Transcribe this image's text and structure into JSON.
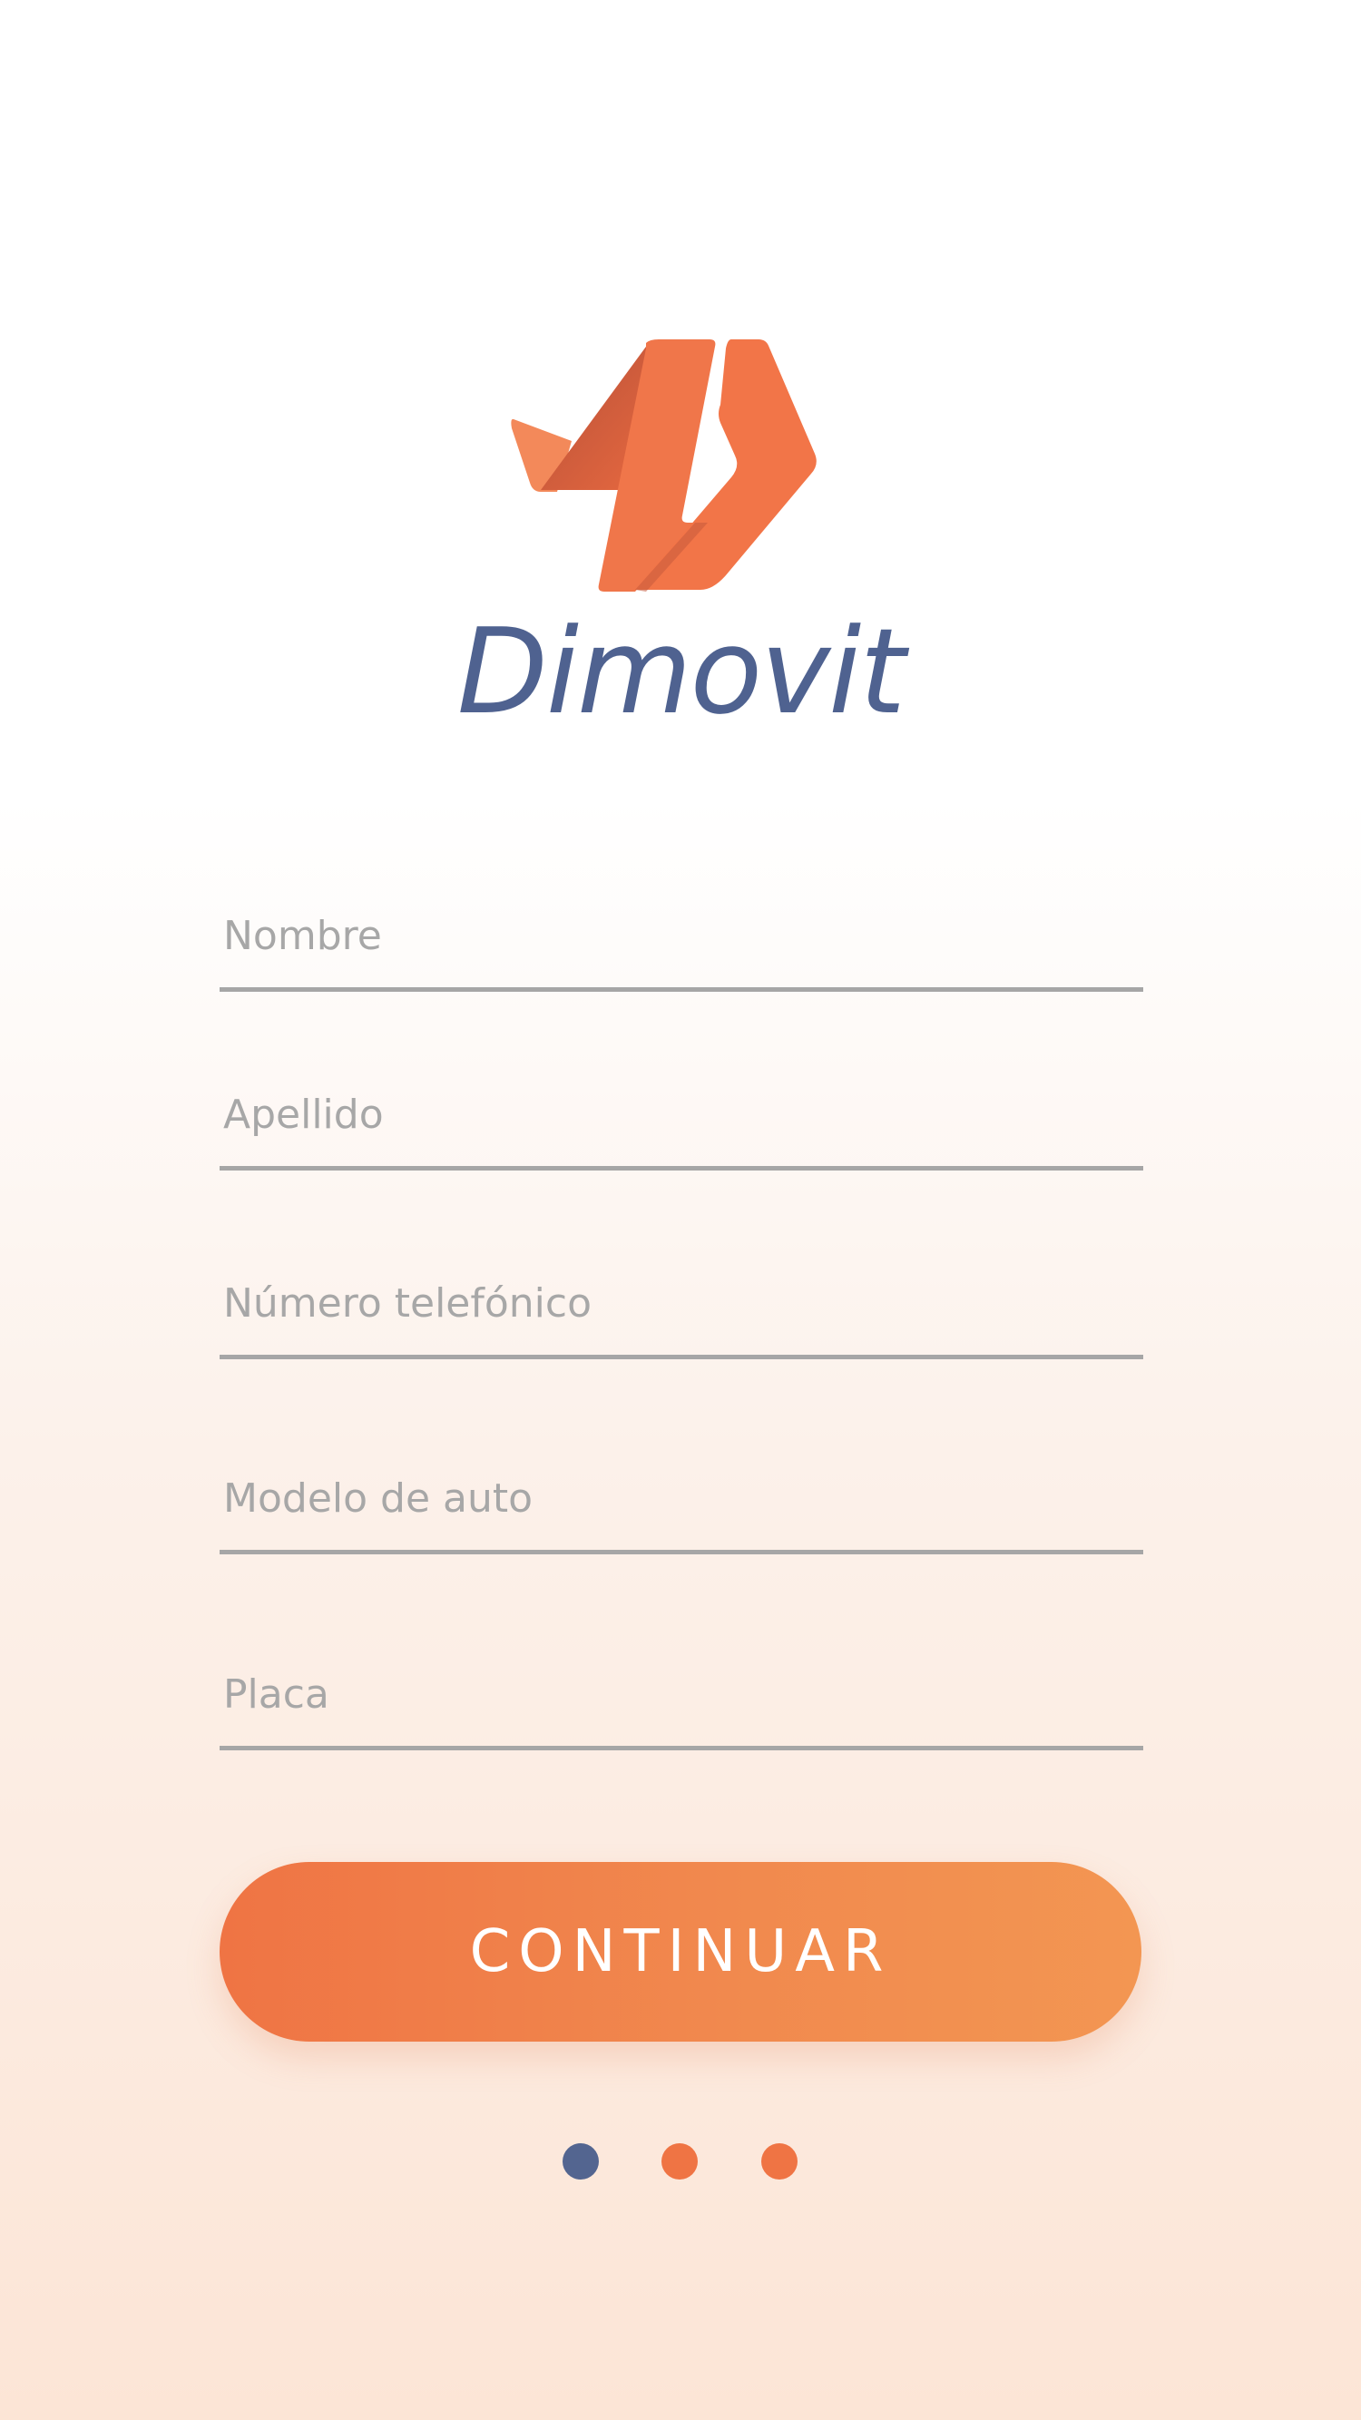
{
  "brand": {
    "name": "Dimovit",
    "logo_icon": "dimovit-logo-mark"
  },
  "form": {
    "fields": [
      {
        "name": "first-name-field",
        "placeholder": "Nombre",
        "value": ""
      },
      {
        "name": "last-name-field",
        "placeholder": "Apellido",
        "value": ""
      },
      {
        "name": "phone-number-field",
        "placeholder": "Número telefónico",
        "value": ""
      },
      {
        "name": "car-model-field",
        "placeholder": "Modelo de auto",
        "value": ""
      },
      {
        "name": "license-plate-field",
        "placeholder": "Placa",
        "value": ""
      }
    ]
  },
  "continue_button": {
    "label": "CONTINUAR"
  },
  "pagination": {
    "total": 3,
    "current": 1,
    "active_color": "#536590",
    "inactive_color": "#ef7444"
  },
  "colors": {
    "accent": "#ef7444",
    "brand_text": "#4f6290",
    "field_line": "#a6a6a6",
    "placeholder": "#a7a7a7"
  }
}
